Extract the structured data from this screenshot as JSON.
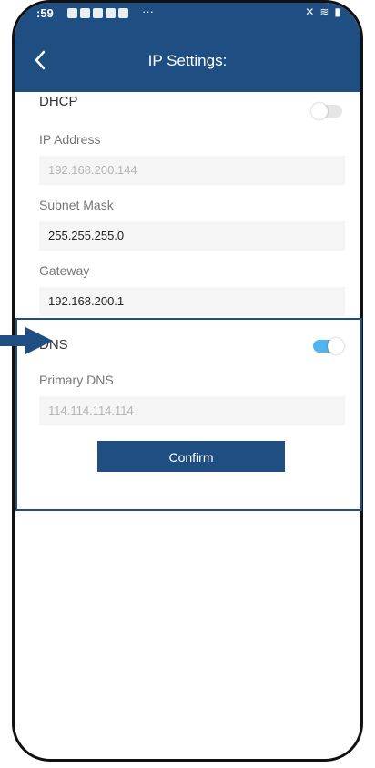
{
  "status": {
    "time": ":59",
    "more": "···"
  },
  "header": {
    "title": "IP Settings:"
  },
  "dhcp": {
    "label": "DHCP",
    "toggle": "off"
  },
  "fields": {
    "ip_label": "IP Address",
    "ip_value": "192.168.200.144",
    "subnet_label": "Subnet Mask",
    "subnet_value": "255.255.255.0",
    "gateway_label": "Gateway",
    "gateway_value": "192.168.200.1"
  },
  "dns": {
    "label": "DNS",
    "toggle": "on",
    "primary_label": "Primary DNS",
    "primary_value": "114.114.114.114"
  },
  "actions": {
    "confirm_label": "Confirm"
  },
  "colors": {
    "brand": "#1f4f82",
    "toggle_on": "#51b4ef"
  },
  "icons": [
    "back-chevron-icon",
    "wifi-icon",
    "battery-icon",
    "mute-icon",
    "pointer-arrow-icon"
  ]
}
